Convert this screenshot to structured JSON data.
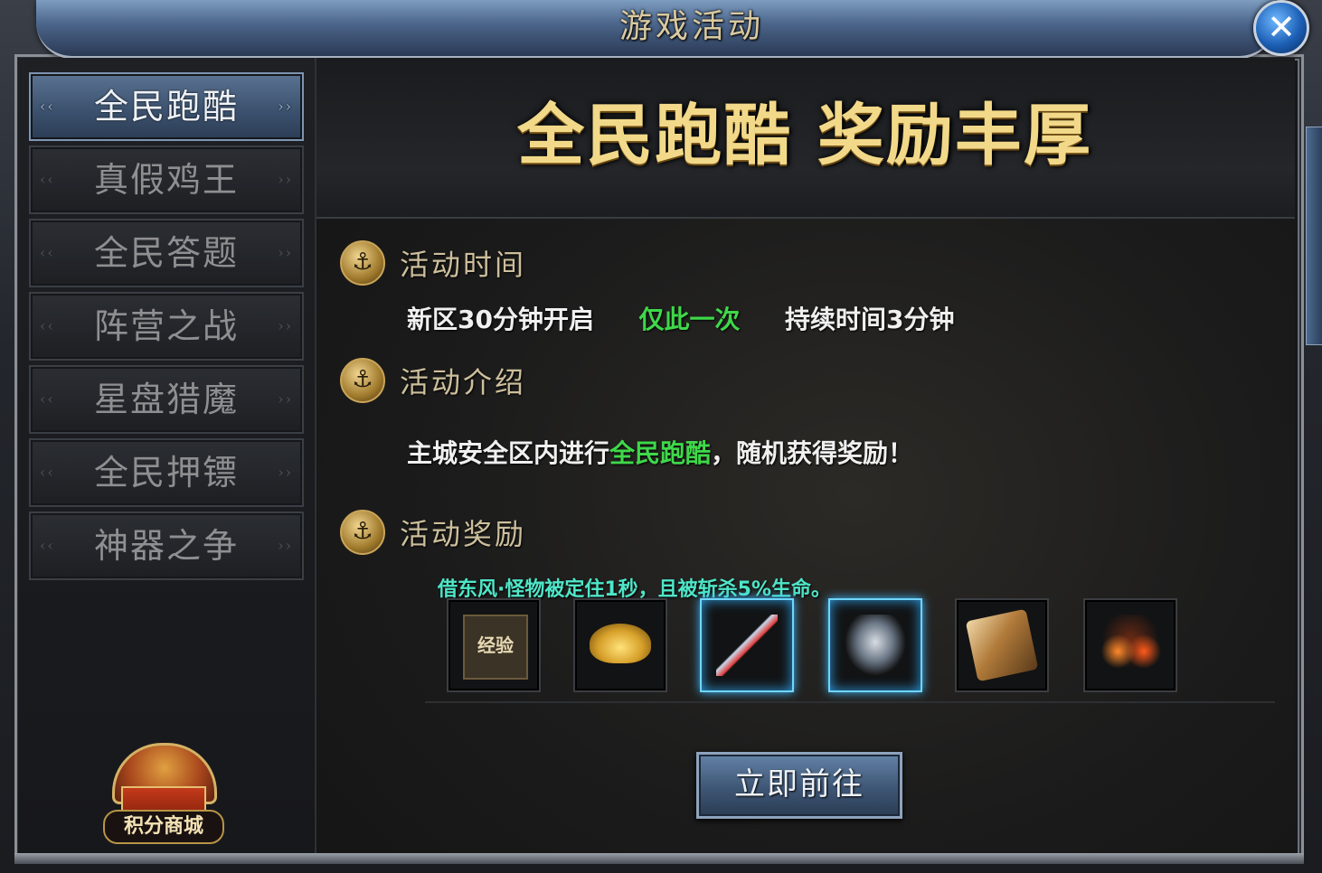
{
  "window": {
    "title": "游戏活动",
    "close_icon": "✕"
  },
  "sidebar": {
    "items": [
      {
        "label": "全民跑酷",
        "active": true
      },
      {
        "label": "真假鸡王",
        "active": false
      },
      {
        "label": "全民答题",
        "active": false
      },
      {
        "label": "阵营之战",
        "active": false
      },
      {
        "label": "星盘猎魔",
        "active": false
      },
      {
        "label": "全民押镖",
        "active": false
      },
      {
        "label": "神器之争",
        "active": false
      }
    ],
    "shop_label": "积分商城"
  },
  "main": {
    "banner_title": "全民跑酷 奖励丰厚",
    "time_section": {
      "title": "活动时间",
      "open_text": "新区30分钟开启",
      "once_text": "仅此一次",
      "duration_text": "持续时间3分钟"
    },
    "intro_section": {
      "title": "活动介绍",
      "prefix": "主城安全区内进行",
      "highlight": "全民跑酷",
      "suffix": "，随机获得奖励！"
    },
    "reward_section": {
      "title": "活动奖励",
      "tooltip": "借东风·怪物被定住1秒，且被斩杀5%生命。",
      "items": [
        {
          "icon": "exp-icon",
          "text": "经验"
        },
        {
          "icon": "gold-ingot-icon"
        },
        {
          "icon": "sword-icon"
        },
        {
          "icon": "angel-statue-icon"
        },
        {
          "icon": "scroll-icon"
        },
        {
          "icon": "flame-bike-icon"
        }
      ]
    },
    "go_button": "立即前往"
  },
  "colors": {
    "accent_gold": "#f2d98a",
    "highlight_green": "#3fd84a",
    "tooltip_cyan": "#4ee6c8",
    "active_tab_blue": "#3c526f"
  }
}
